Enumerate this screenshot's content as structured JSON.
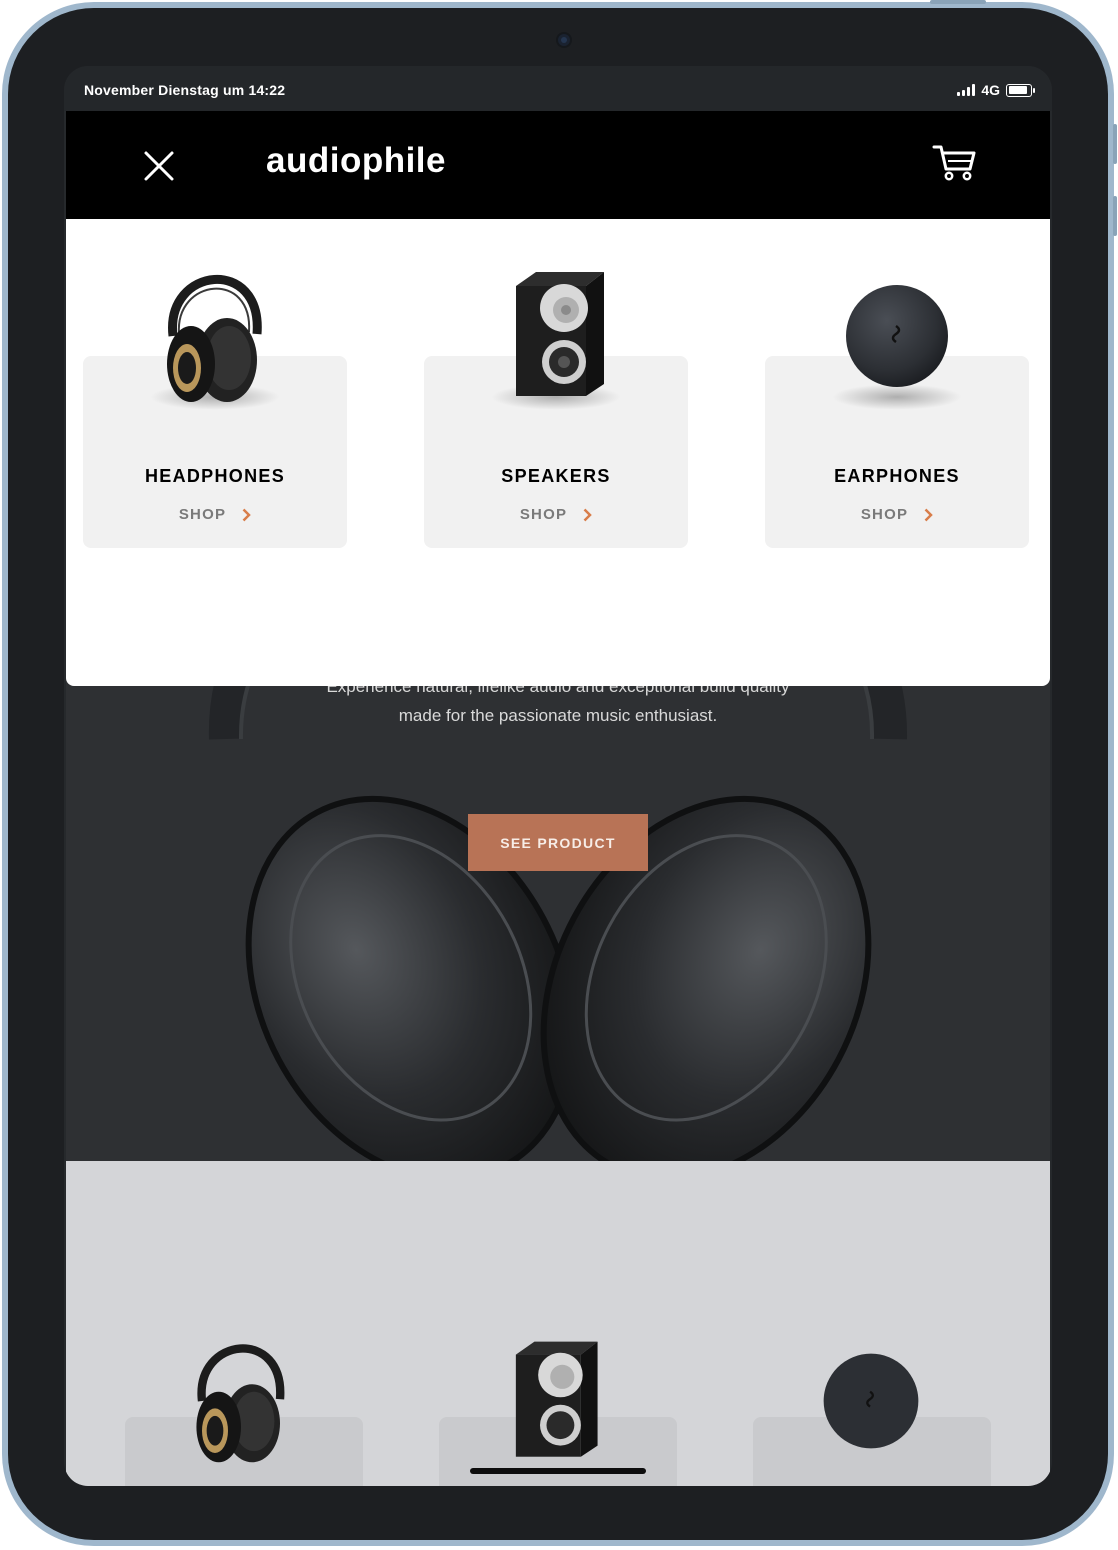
{
  "status_bar": {
    "time": "November Dienstag um 14:22",
    "network": "4G"
  },
  "header": {
    "logo": "audiophile",
    "close_icon": "close-icon",
    "cart_icon": "cart-icon"
  },
  "menu": {
    "categories": [
      {
        "title": "HEADPHONES",
        "shop_label": "SHOP"
      },
      {
        "title": "SPEAKERS",
        "shop_label": "SHOP"
      },
      {
        "title": "EARPHONES",
        "shop_label": "SHOP"
      }
    ]
  },
  "hero": {
    "description": "Experience natural, lifelike audio and exceptional build quality made for the passionate music enthusiast.",
    "cta_label": "SEE PRODUCT"
  },
  "colors": {
    "accent": "#D87D4A",
    "button": "#B87356",
    "header_bg": "#000000",
    "hero_bg": "#2E3033",
    "card_bg": "#F1F1F1"
  }
}
